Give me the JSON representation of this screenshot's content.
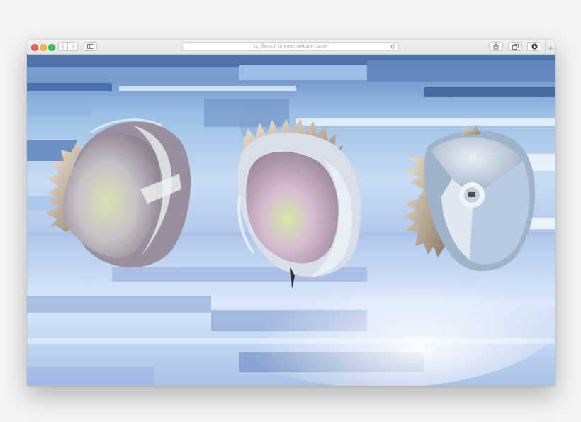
{
  "browser": {
    "address_placeholder": "Search or enter website name"
  },
  "colors": {
    "close": "#fc605b",
    "minimize": "#fdbc40",
    "maximize": "#34c84a",
    "sky_dark": "#4a6ea8",
    "sky_light": "#dfeefa"
  },
  "icons": [
    "back-icon",
    "forward-icon",
    "sidebar-icon",
    "search-icon",
    "reload-icon",
    "share-icon",
    "tabs-icon",
    "download-icon",
    "plus-icon"
  ],
  "content": {
    "scene": "three-shell-sculptures-floating-over-glitched-sky"
  }
}
